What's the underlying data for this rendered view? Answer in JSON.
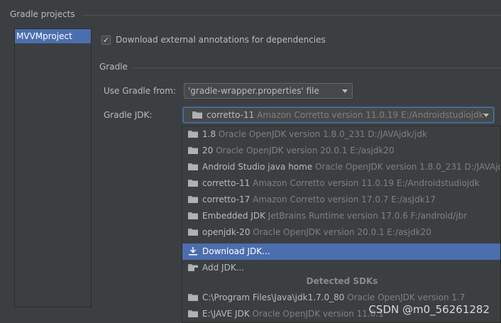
{
  "section": {
    "title": "Gradle projects"
  },
  "projects": [
    "MVVMproject"
  ],
  "annotations_checkbox": {
    "label": "Download external annotations for dependencies",
    "checked": true
  },
  "gradle": {
    "title": "Gradle",
    "use_from_label": "Use Gradle from:",
    "use_from_value": "'gradle-wrapper.properties' file",
    "jdk_label": "Gradle JDK:",
    "jdk_selected_name": "corretto-11",
    "jdk_selected_detail": "Amazon Corretto version 11.0.19 E:/Androidstudiojdk"
  },
  "dropdown": {
    "items": [
      {
        "name": "1.8",
        "detail": "Oracle OpenJDK version 1.8.0_231 D:/JAVAjdk/jdk",
        "icon": "folder-icon"
      },
      {
        "name": "20",
        "detail": "Oracle OpenJDK version 20.0.1 E:/asjdk20",
        "icon": "folder-icon"
      },
      {
        "name": "Android Studio java home",
        "detail": "Oracle OpenJDK version 1.8.0_231 D:/JAVAjd",
        "icon": "folder-icon"
      },
      {
        "name": "corretto-11",
        "detail": "Amazon Corretto version 11.0.19 E:/Androidstudiojdk",
        "icon": "folder-icon"
      },
      {
        "name": "corretto-17",
        "detail": "Amazon Corretto version 17.0.7 E:/asJdk17",
        "icon": "folder-icon"
      },
      {
        "name": "Embedded JDK",
        "detail": "JetBrains Runtime version 17.0.6 F:/android/jbr",
        "icon": "folder-icon"
      },
      {
        "name": "openjdk-20",
        "detail": "Oracle OpenJDK version 20.0.1 E:/asjdk20",
        "icon": "folder-icon"
      }
    ],
    "download_label": "Download JDK...",
    "add_label": "Add JDK...",
    "detected_header": "Detected SDKs",
    "detected": [
      {
        "name": "C:\\Program Files\\Java\\jdk1.7.0_80",
        "detail": "Oracle OpenJDK version 1.7",
        "icon": "folder-icon"
      },
      {
        "name": "E:\\JAVE JDK",
        "detail": "Oracle OpenJDK version 11.0.1",
        "icon": "folder-icon"
      }
    ]
  },
  "watermark": "CSDN @m0_56261282",
  "colors": {
    "background": "#3c3f41",
    "selection": "#4b6eaf",
    "text": "#bbbbbb",
    "dim_text": "#808080"
  }
}
